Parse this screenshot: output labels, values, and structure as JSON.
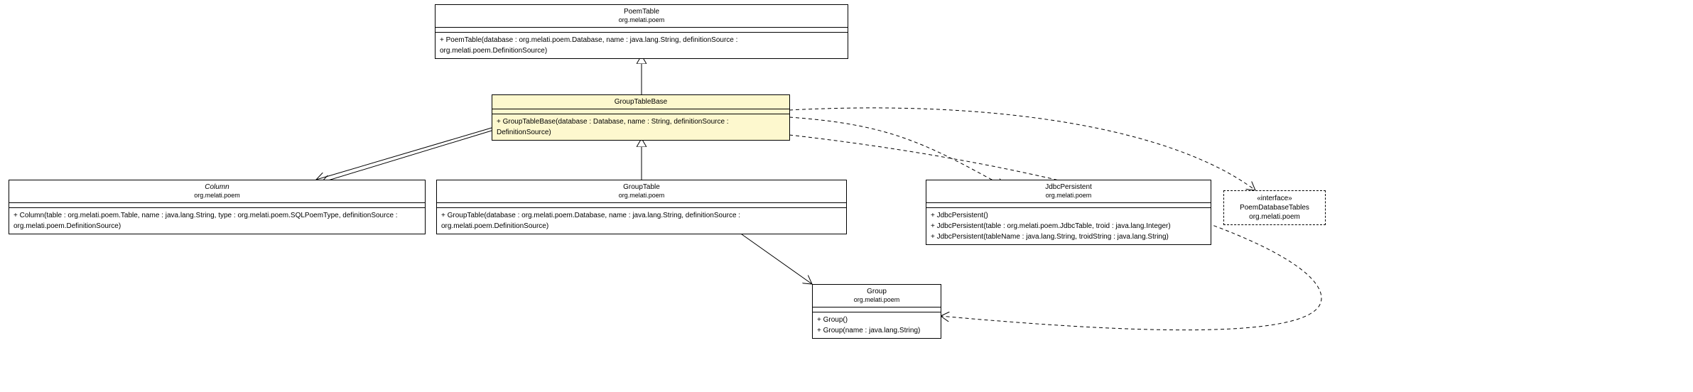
{
  "classes": {
    "PoemTable": {
      "name": "PoemTable",
      "pkg": "org.melati.poem",
      "ops": [
        "+ PoemTable(database : org.melati.poem.Database, name : java.lang.String, definitionSource : org.melati.poem.DefinitionSource)"
      ]
    },
    "GroupTableBase": {
      "name": "GroupTableBase",
      "pkg": "",
      "ops": [
        "+ GroupTableBase(database : Database, name : String, definitionSource : DefinitionSource)"
      ]
    },
    "Column": {
      "name": "Column",
      "pkg": "org.melati.poem",
      "ops": [
        "+ Column(table : org.melati.poem.Table, name : java.lang.String, type : org.melati.poem.SQLPoemType, definitionSource : org.melati.poem.DefinitionSource)"
      ]
    },
    "GroupTable": {
      "name": "GroupTable",
      "pkg": "org.melati.poem",
      "ops": [
        "+ GroupTable(database : org.melati.poem.Database, name : java.lang.String, definitionSource : org.melati.poem.DefinitionSource)"
      ]
    },
    "JdbcPersistent": {
      "name": "JdbcPersistent",
      "pkg": "org.melati.poem",
      "ops": [
        "+ JdbcPersistent()",
        "+ JdbcPersistent(table : org.melati.poem.JdbcTable, troid : java.lang.Integer)",
        "+ JdbcPersistent(tableName : java.lang.String, troidString : java.lang.String)"
      ]
    },
    "Group": {
      "name": "Group",
      "pkg": "org.melati.poem",
      "ops": [
        "+ Group()",
        "+ Group(name : java.lang.String)"
      ]
    }
  },
  "interface": {
    "stereo": "«interface»",
    "name": "PoemDatabaseTables",
    "pkg": "org.melati.poem"
  }
}
